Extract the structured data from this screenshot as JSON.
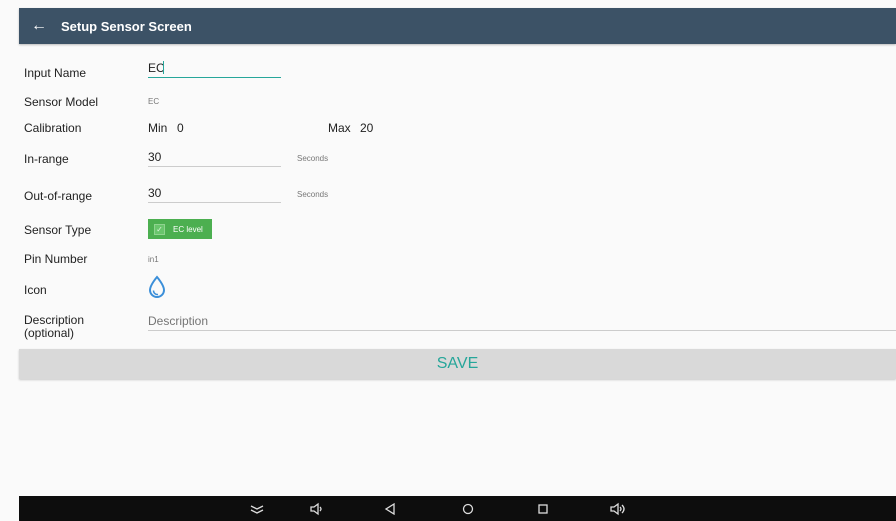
{
  "appbar": {
    "back_icon": "arrow-left-icon",
    "title": "Setup Sensor Screen"
  },
  "form": {
    "input_name": {
      "label": "Input Name",
      "value": "EC"
    },
    "sensor_model": {
      "label": "Sensor Model",
      "value": "EC"
    },
    "calibration": {
      "label": "Calibration",
      "min_label": "Min",
      "min_value": "0",
      "max_label": "Max",
      "max_value": "20"
    },
    "in_range": {
      "label": "In-range",
      "value": "30",
      "unit": "Seconds"
    },
    "out_of_range": {
      "label": "Out-of-range",
      "value": "30",
      "unit": "Seconds"
    },
    "sensor_type": {
      "label": "Sensor Type",
      "chip_label": "EC level",
      "checked": true
    },
    "pin_number": {
      "label": "Pin Number",
      "value": "in1"
    },
    "icon": {
      "label": "Icon",
      "icon_name": "water-drop-icon"
    },
    "description": {
      "label_line1": "Description",
      "label_line2": "(optional)",
      "placeholder": "Description"
    }
  },
  "save_label": "SAVE",
  "navbar": {
    "icons": [
      "keyboard-hide-icon",
      "volume-down-icon",
      "back-icon",
      "home-icon",
      "recents-icon",
      "volume-up-icon"
    ]
  },
  "colors": {
    "appbar": "#3c5266",
    "accent": "#26a69a",
    "chip": "#4caf50",
    "save_bar": "#d9d9d9",
    "navbar": "#0d0d0d"
  }
}
